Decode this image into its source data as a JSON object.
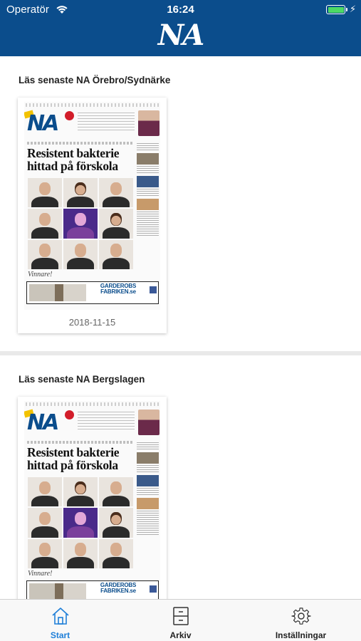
{
  "status_bar": {
    "carrier": "Operatör",
    "time": "16:24",
    "battery_level": 1.0
  },
  "header": {
    "brand": "NA"
  },
  "sections": [
    {
      "title": "Läs senaste NA Örebro/Sydnärke",
      "issue_date": "2018-11-15",
      "cover": {
        "headline": "Resistent bakterie hittad på förskola",
        "caption": "Vinnare!",
        "ad_text": "GARDEROBS FABRIKEN.se"
      }
    },
    {
      "title": "Läs senaste NA Bergslagen",
      "issue_date": "",
      "cover": {
        "headline": "Resistent bakterie hittad på förskola",
        "caption": "Vinnare!",
        "ad_text": "GARDEROBS FABRIKEN.se"
      }
    }
  ],
  "tabs": [
    {
      "label": "Start",
      "icon": "home-icon",
      "active": true
    },
    {
      "label": "Arkiv",
      "icon": "archive-icon",
      "active": false
    },
    {
      "label": "Inställningar",
      "icon": "gear-icon",
      "active": false
    }
  ],
  "colors": {
    "header_bg": "#0b4d8c",
    "active_tab": "#1f7fd8",
    "battery": "#4cd964"
  }
}
